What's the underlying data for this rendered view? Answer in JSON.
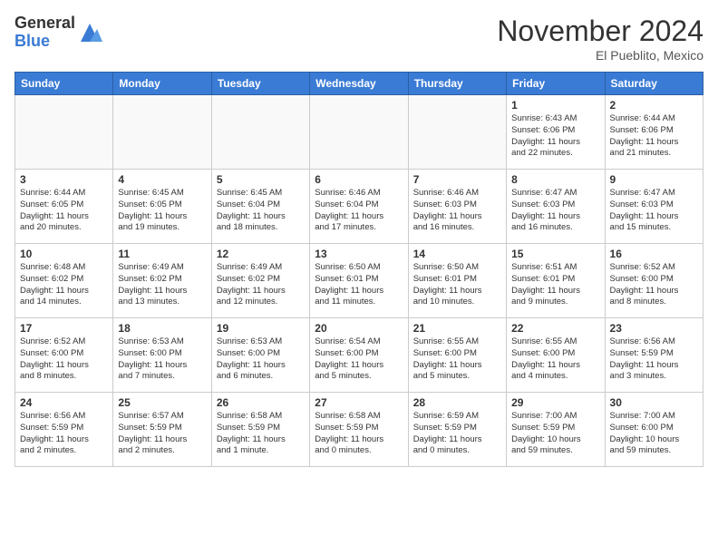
{
  "header": {
    "logo_general": "General",
    "logo_blue": "Blue",
    "month_title": "November 2024",
    "location": "El Pueblito, Mexico"
  },
  "days_of_week": [
    "Sunday",
    "Monday",
    "Tuesday",
    "Wednesday",
    "Thursday",
    "Friday",
    "Saturday"
  ],
  "weeks": [
    [
      {
        "day": "",
        "info": ""
      },
      {
        "day": "",
        "info": ""
      },
      {
        "day": "",
        "info": ""
      },
      {
        "day": "",
        "info": ""
      },
      {
        "day": "",
        "info": ""
      },
      {
        "day": "1",
        "info": "Sunrise: 6:43 AM\nSunset: 6:06 PM\nDaylight: 11 hours\nand 22 minutes."
      },
      {
        "day": "2",
        "info": "Sunrise: 6:44 AM\nSunset: 6:06 PM\nDaylight: 11 hours\nand 21 minutes."
      }
    ],
    [
      {
        "day": "3",
        "info": "Sunrise: 6:44 AM\nSunset: 6:05 PM\nDaylight: 11 hours\nand 20 minutes."
      },
      {
        "day": "4",
        "info": "Sunrise: 6:45 AM\nSunset: 6:05 PM\nDaylight: 11 hours\nand 19 minutes."
      },
      {
        "day": "5",
        "info": "Sunrise: 6:45 AM\nSunset: 6:04 PM\nDaylight: 11 hours\nand 18 minutes."
      },
      {
        "day": "6",
        "info": "Sunrise: 6:46 AM\nSunset: 6:04 PM\nDaylight: 11 hours\nand 17 minutes."
      },
      {
        "day": "7",
        "info": "Sunrise: 6:46 AM\nSunset: 6:03 PM\nDaylight: 11 hours\nand 16 minutes."
      },
      {
        "day": "8",
        "info": "Sunrise: 6:47 AM\nSunset: 6:03 PM\nDaylight: 11 hours\nand 16 minutes."
      },
      {
        "day": "9",
        "info": "Sunrise: 6:47 AM\nSunset: 6:03 PM\nDaylight: 11 hours\nand 15 minutes."
      }
    ],
    [
      {
        "day": "10",
        "info": "Sunrise: 6:48 AM\nSunset: 6:02 PM\nDaylight: 11 hours\nand 14 minutes."
      },
      {
        "day": "11",
        "info": "Sunrise: 6:49 AM\nSunset: 6:02 PM\nDaylight: 11 hours\nand 13 minutes."
      },
      {
        "day": "12",
        "info": "Sunrise: 6:49 AM\nSunset: 6:02 PM\nDaylight: 11 hours\nand 12 minutes."
      },
      {
        "day": "13",
        "info": "Sunrise: 6:50 AM\nSunset: 6:01 PM\nDaylight: 11 hours\nand 11 minutes."
      },
      {
        "day": "14",
        "info": "Sunrise: 6:50 AM\nSunset: 6:01 PM\nDaylight: 11 hours\nand 10 minutes."
      },
      {
        "day": "15",
        "info": "Sunrise: 6:51 AM\nSunset: 6:01 PM\nDaylight: 11 hours\nand 9 minutes."
      },
      {
        "day": "16",
        "info": "Sunrise: 6:52 AM\nSunset: 6:00 PM\nDaylight: 11 hours\nand 8 minutes."
      }
    ],
    [
      {
        "day": "17",
        "info": "Sunrise: 6:52 AM\nSunset: 6:00 PM\nDaylight: 11 hours\nand 8 minutes."
      },
      {
        "day": "18",
        "info": "Sunrise: 6:53 AM\nSunset: 6:00 PM\nDaylight: 11 hours\nand 7 minutes."
      },
      {
        "day": "19",
        "info": "Sunrise: 6:53 AM\nSunset: 6:00 PM\nDaylight: 11 hours\nand 6 minutes."
      },
      {
        "day": "20",
        "info": "Sunrise: 6:54 AM\nSunset: 6:00 PM\nDaylight: 11 hours\nand 5 minutes."
      },
      {
        "day": "21",
        "info": "Sunrise: 6:55 AM\nSunset: 6:00 PM\nDaylight: 11 hours\nand 5 minutes."
      },
      {
        "day": "22",
        "info": "Sunrise: 6:55 AM\nSunset: 6:00 PM\nDaylight: 11 hours\nand 4 minutes."
      },
      {
        "day": "23",
        "info": "Sunrise: 6:56 AM\nSunset: 5:59 PM\nDaylight: 11 hours\nand 3 minutes."
      }
    ],
    [
      {
        "day": "24",
        "info": "Sunrise: 6:56 AM\nSunset: 5:59 PM\nDaylight: 11 hours\nand 2 minutes."
      },
      {
        "day": "25",
        "info": "Sunrise: 6:57 AM\nSunset: 5:59 PM\nDaylight: 11 hours\nand 2 minutes."
      },
      {
        "day": "26",
        "info": "Sunrise: 6:58 AM\nSunset: 5:59 PM\nDaylight: 11 hours\nand 1 minute."
      },
      {
        "day": "27",
        "info": "Sunrise: 6:58 AM\nSunset: 5:59 PM\nDaylight: 11 hours\nand 0 minutes."
      },
      {
        "day": "28",
        "info": "Sunrise: 6:59 AM\nSunset: 5:59 PM\nDaylight: 11 hours\nand 0 minutes."
      },
      {
        "day": "29",
        "info": "Sunrise: 7:00 AM\nSunset: 5:59 PM\nDaylight: 10 hours\nand 59 minutes."
      },
      {
        "day": "30",
        "info": "Sunrise: 7:00 AM\nSunset: 6:00 PM\nDaylight: 10 hours\nand 59 minutes."
      }
    ]
  ]
}
